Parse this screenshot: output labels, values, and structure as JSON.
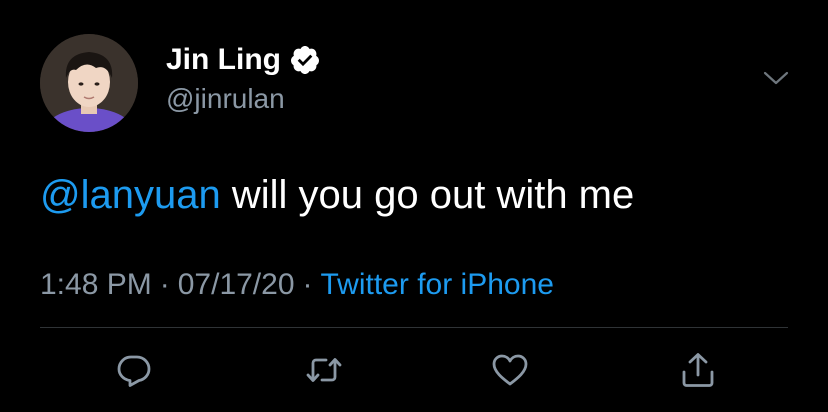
{
  "user": {
    "display_name": "Jin Ling",
    "handle": "@jinrulan",
    "verified": true
  },
  "tweet": {
    "mention": "@lanyuan",
    "text": " will you go out with me"
  },
  "meta": {
    "time": "1:48 PM",
    "separator": "·",
    "date": "07/17/20",
    "source": "Twitter for iPhone"
  },
  "icons": {
    "verified": "verified-badge-icon",
    "caret": "chevron-down-icon",
    "reply": "reply-icon",
    "retweet": "retweet-icon",
    "like": "heart-icon",
    "share": "share-icon"
  },
  "colors": {
    "background": "#000000",
    "text": "#ffffff",
    "secondary": "#8b98a5",
    "link": "#1d9bf0",
    "divider": "#2f3336"
  }
}
